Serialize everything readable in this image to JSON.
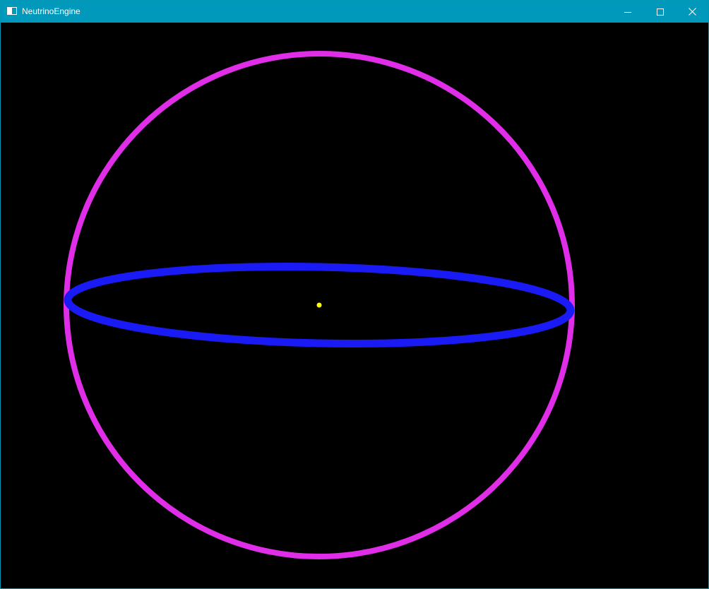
{
  "window": {
    "title": "NeutrinoEngine",
    "icon": "app-window-icon",
    "controls": [
      {
        "name": "minimize",
        "icon": "minimize-icon"
      },
      {
        "name": "maximize",
        "icon": "maximize-icon"
      },
      {
        "name": "close",
        "icon": "close-icon"
      }
    ]
  },
  "colors": {
    "titlebar": "#0099bc",
    "background": "#000000",
    "outer_ring": "#e02ee8",
    "equator_ring": "#1a1af5",
    "center_point": "#ffff00"
  }
}
